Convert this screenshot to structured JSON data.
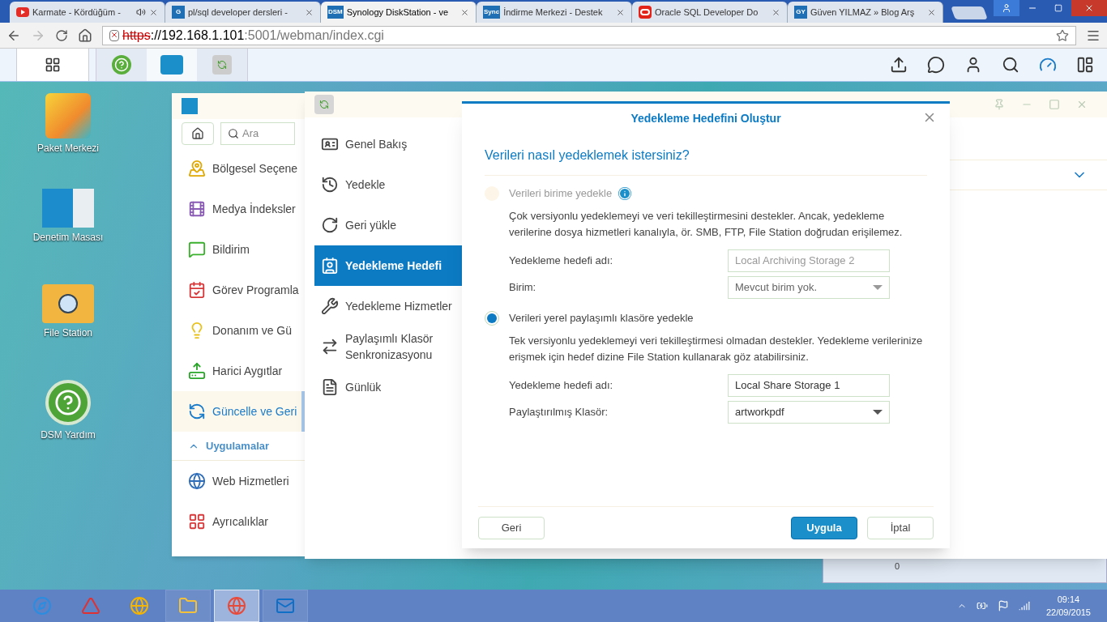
{
  "browser": {
    "tabs": [
      {
        "title": "Karmate - Kördüğüm -",
        "audio": true,
        "selected": false
      },
      {
        "title": "pl/sql developer dersleri -",
        "favicon_text": "G",
        "audio": false,
        "selected": false
      },
      {
        "title": "Synology DiskStation - ve",
        "favicon_text": "DSM",
        "audio": false,
        "selected": true
      },
      {
        "title": "İndirme Merkezi - Destek",
        "favicon_text": "Sync",
        "audio": false,
        "selected": false
      },
      {
        "title": "Oracle SQL Developer Do",
        "audio": false,
        "selected": false
      },
      {
        "title": "Güven YILMAZ » Blog Arş",
        "favicon_text": "GY",
        "audio": false,
        "selected": false
      }
    ],
    "address": {
      "scheme": "https",
      "host": "://192.168.1.101",
      "rest": ":5001/webman/index.cgi",
      "insecure": true
    }
  },
  "desktop_icons": [
    {
      "label": "Paket Merkezi"
    },
    {
      "label": "Denetim Masası"
    },
    {
      "label": "File Station"
    },
    {
      "label": "DSM Yardım"
    }
  ],
  "control_panel": {
    "search": {
      "placeholder": "Ara"
    },
    "items": [
      {
        "label": "Bölgesel Seçene",
        "selected": false
      },
      {
        "label": "Medya İndeksler",
        "selected": false
      },
      {
        "label": "Bildirim",
        "selected": false
      },
      {
        "label": "Görev Programla",
        "selected": false
      },
      {
        "label": "Donanım ve Gü",
        "selected": false
      },
      {
        "label": "Harici Aygıtlar",
        "selected": false
      },
      {
        "label": "Güncelle ve Geri",
        "selected": true
      }
    ],
    "section": {
      "label": "Uygulamalar",
      "expanded": true
    },
    "section_items": [
      {
        "label": "Web Hizmetleri",
        "selected": false
      },
      {
        "label": "Ayrıcalıklar",
        "selected": false
      }
    ]
  },
  "backup_app": {
    "nav": [
      {
        "label": "Genel Bakış",
        "selected": false
      },
      {
        "label": "Yedekle",
        "selected": false
      },
      {
        "label": "Geri yükle",
        "selected": false
      },
      {
        "label": "Yedekleme Hedefi",
        "selected": true
      },
      {
        "label": "Yedekleme Hizmetler",
        "selected": false
      },
      {
        "label": "Paylaşımlı Klasör Senkronizasyonu",
        "selected": false
      },
      {
        "label": "Günlük",
        "selected": false
      }
    ]
  },
  "dialog": {
    "title": "Yedekleme Hedefini Oluştur",
    "heading": "Verileri nasıl yedeklemek istersiniz?",
    "options": [
      {
        "label": "Verileri birime yedekle",
        "selected": false,
        "disabled": true,
        "info": true,
        "description": "Çok versiyonlu yedeklemeyi ve veri tekilleştirmesini destekler. Ancak, yedekleme verilerine dosya hizmetleri kanalıyla, ör. SMB, FTP, File Station doğrudan erişilemez.",
        "fields": [
          {
            "label": "Yedekleme hedefi adı:",
            "value": "Local Archiving Storage 2",
            "kind": "text"
          },
          {
            "label": "Birim:",
            "value": "Mevcut birim yok.",
            "kind": "select"
          }
        ]
      },
      {
        "label": "Verileri yerel paylaşımlı klasöre yedekle",
        "selected": true,
        "disabled": false,
        "info": false,
        "description": "Tek versiyonlu yedeklemeyi veri tekilleştirmesi olmadan destekler. Yedekleme verilerinize erişmek için hedef dizine File Station kullanarak göz atabilirsiniz.",
        "fields": [
          {
            "label": "Yedekleme hedefi adı:",
            "value": "Local Share Storage 1",
            "kind": "text"
          },
          {
            "label": "Paylaştırılmış Klasör:",
            "value": "artworkpdf",
            "kind": "select"
          }
        ]
      }
    ],
    "buttons": [
      {
        "label": "Geri",
        "kind": "secondary"
      },
      {
        "label": "Uygula",
        "kind": "primary"
      },
      {
        "label": "İptal",
        "kind": "secondary"
      }
    ]
  },
  "widget": {
    "value": "0"
  },
  "taskbar": {
    "apps": [
      {
        "selected": false
      },
      {
        "selected": false
      },
      {
        "selected": false
      },
      {
        "selected": false
      },
      {
        "selected": true
      },
      {
        "selected": false
      }
    ],
    "time": "09:14",
    "date": "22/09/2015"
  }
}
